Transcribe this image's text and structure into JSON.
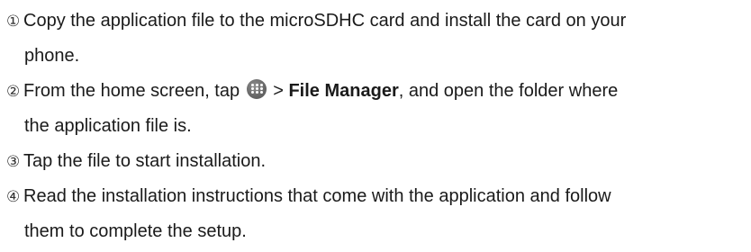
{
  "steps": [
    {
      "number": "①",
      "line1": "Copy the application file to the microSDHC card and install the card on your",
      "line2": "phone."
    },
    {
      "number": "②",
      "line1_before_icon": "From the home screen, tap",
      "icon": "apps-icon",
      "separator": " > ",
      "bold_text": "File Manager",
      "line1_after_bold": ", and open the folder where",
      "line2": "the application file is."
    },
    {
      "number": "③",
      "line1": "Tap the file to start installation."
    },
    {
      "number": "④",
      "line1": "Read the installation instructions that come with the application and follow",
      "line2": "them to complete the setup."
    }
  ]
}
